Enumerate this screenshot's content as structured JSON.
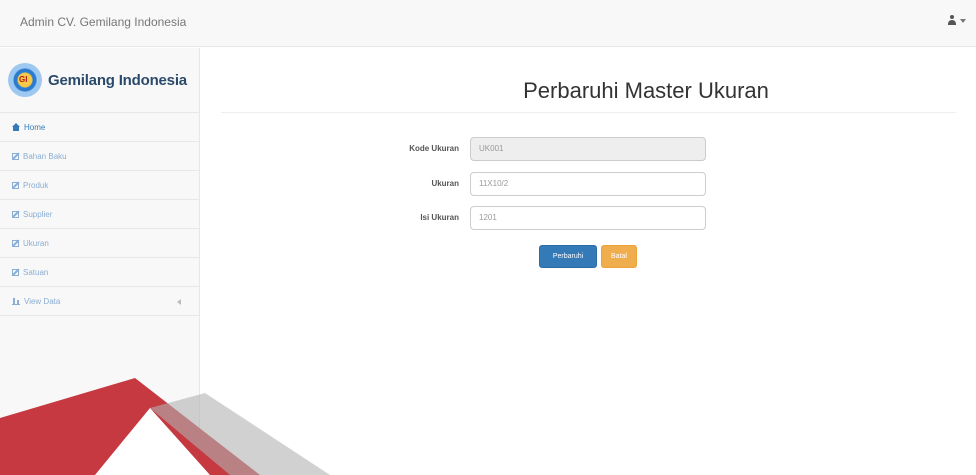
{
  "topbar": {
    "brand": "Admin CV. Gemilang Indonesia"
  },
  "sidebar": {
    "logo_text": "Gemilang Indonesia",
    "logo_emblem_text": "GI",
    "items": [
      {
        "label": "Home",
        "icon": "home-icon"
      },
      {
        "label": "Bahan Baku",
        "icon": "edit-icon"
      },
      {
        "label": "Produk",
        "icon": "edit-icon"
      },
      {
        "label": "Supplier",
        "icon": "edit-icon"
      },
      {
        "label": "Ukuran",
        "icon": "edit-icon"
      },
      {
        "label": "Satuan",
        "icon": "edit-icon"
      },
      {
        "label": "View Data",
        "icon": "bar-chart-icon"
      }
    ]
  },
  "main": {
    "title": "Perbaruhi Master Ukuran",
    "fields": [
      {
        "label": "Kode Ukuran",
        "value": "UK001",
        "disabled": true
      },
      {
        "label": "Ukuran",
        "value": "11X10/2",
        "disabled": false
      },
      {
        "label": "Isi Ukuran",
        "value": "1201",
        "disabled": false
      }
    ],
    "buttons": {
      "submit": "Perbaruhi",
      "reset": "Batal"
    }
  },
  "colors": {
    "primary": "#337ab7",
    "warning": "#f0ad4e",
    "watermark_red": "#c0232b",
    "watermark_gray": "#b3b3b3"
  }
}
